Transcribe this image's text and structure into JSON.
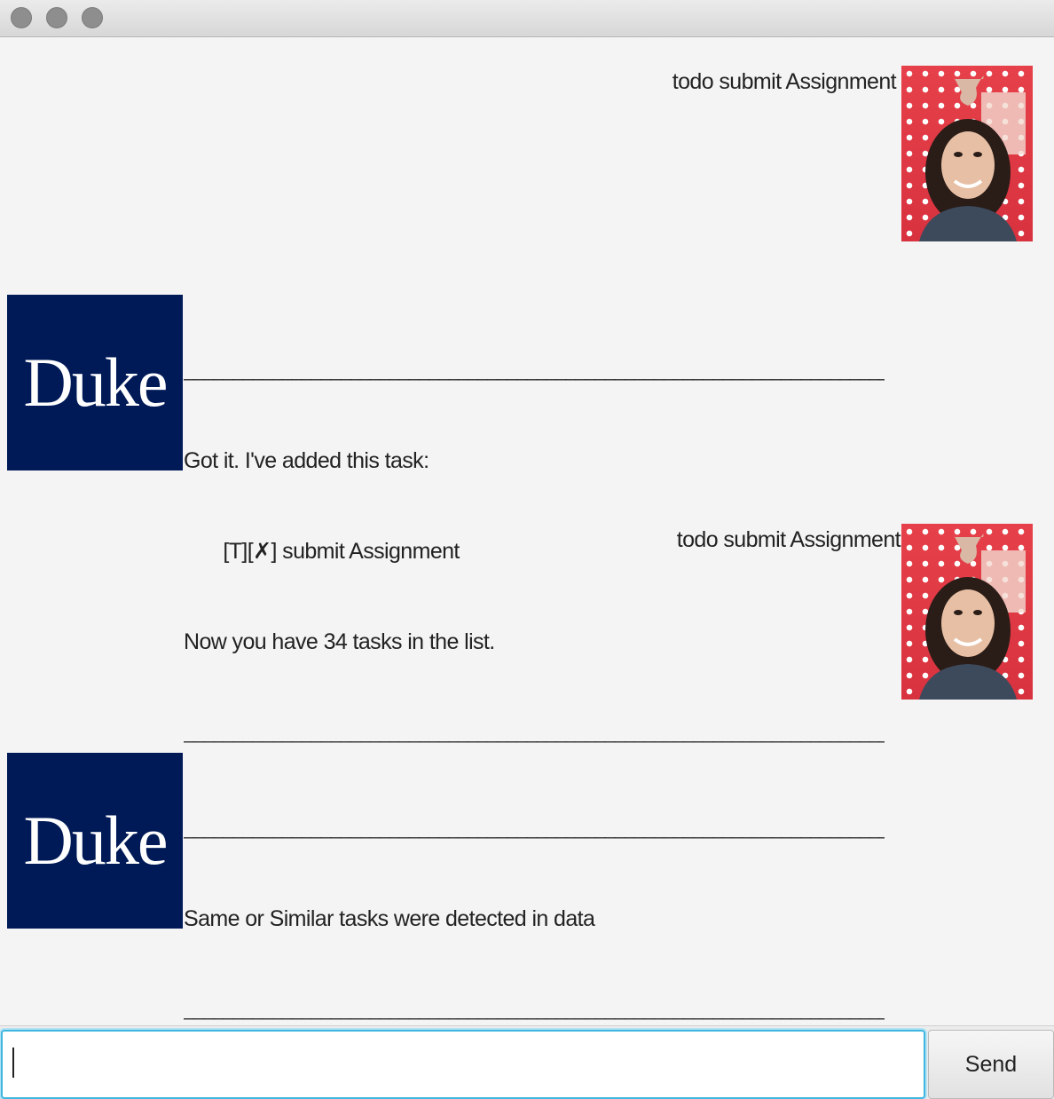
{
  "window": {
    "controls": [
      "close",
      "minimize",
      "zoom"
    ]
  },
  "dialog": {
    "messages": [
      {
        "sender": "user",
        "text": "todo submit Assignment"
      },
      {
        "sender": "duke",
        "avatar_label": "Duke",
        "separator": "________________________________________________________________________________",
        "lines": [
          "Got it. I've added this task:",
          "       [T][✗] submit Assignment",
          "Now you have 34 tasks in the list."
        ]
      },
      {
        "sender": "user",
        "text": "todo submit Assignment"
      },
      {
        "sender": "duke",
        "avatar_label": "Duke",
        "separator": "________________________________________________________________________________",
        "lines": [
          "Same or Similar tasks were detected in data"
        ]
      }
    ]
  },
  "input": {
    "value": "",
    "placeholder": ""
  },
  "send_button": {
    "label": "Send"
  },
  "colors": {
    "duke_navy": "#001a57",
    "focus_ring": "#3fb6e0",
    "background": "#f4f4f4"
  }
}
